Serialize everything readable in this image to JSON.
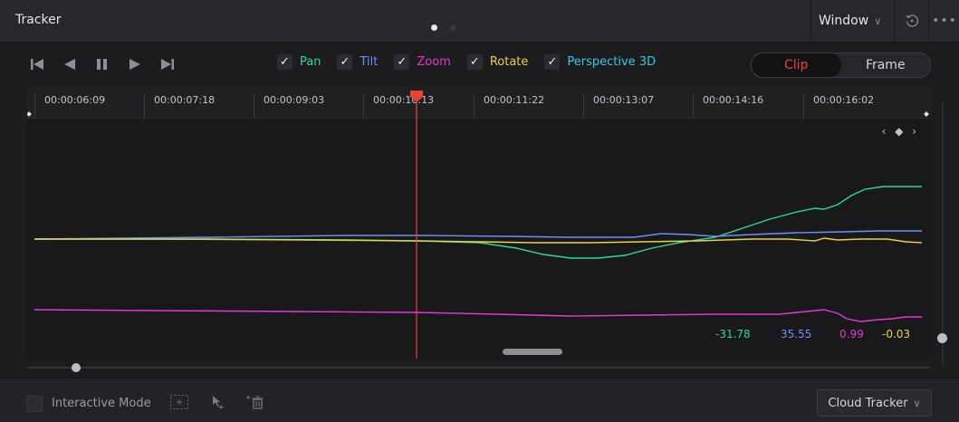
{
  "header": {
    "title": "Tracker",
    "window_label": "Window",
    "page_dots": 2,
    "active_page": 1
  },
  "toolbar": {
    "transport": [
      "skip-to-start-icon",
      "reverse-icon",
      "pause-icon",
      "play-icon",
      "skip-to-end-icon"
    ],
    "channels": [
      {
        "label": "Pan",
        "checked": true,
        "color": "#2ed6a0"
      },
      {
        "label": "Tilt",
        "checked": true,
        "color": "#6f8ff0"
      },
      {
        "label": "Zoom",
        "checked": true,
        "color": "#e23ad0"
      },
      {
        "label": "Rotate",
        "checked": true,
        "color": "#e6d34a"
      },
      {
        "label": "Perspective 3D",
        "checked": true,
        "color": "#35c9e0"
      }
    ],
    "segment": {
      "options": [
        "Clip",
        "Frame"
      ],
      "selected": "Clip"
    }
  },
  "graph": {
    "timecodes": [
      "00:00:06:09",
      "00:00:07:18",
      "00:00:09:03",
      "00:00:10:13",
      "00:00:11:22",
      "00:00:13:07",
      "00:00:14:16",
      "00:00:16:02"
    ],
    "keyframe_nav": "‹ ◆ ›",
    "readouts": [
      {
        "channel": "Pan",
        "value": "-31.78",
        "color": "#2ed6a0"
      },
      {
        "channel": "Tilt",
        "value": "35.55",
        "color": "#6f8ff0"
      },
      {
        "channel": "Zoom",
        "value": "0.99",
        "color": "#e23ad0"
      },
      {
        "channel": "Rotate",
        "value": "-0.03",
        "color": "#e6d34a"
      }
    ],
    "playhead_color": "#e84434"
  },
  "footer": {
    "interactive_mode_label": "Interactive Mode",
    "cloud_tracker_label": "Cloud Tracker"
  }
}
